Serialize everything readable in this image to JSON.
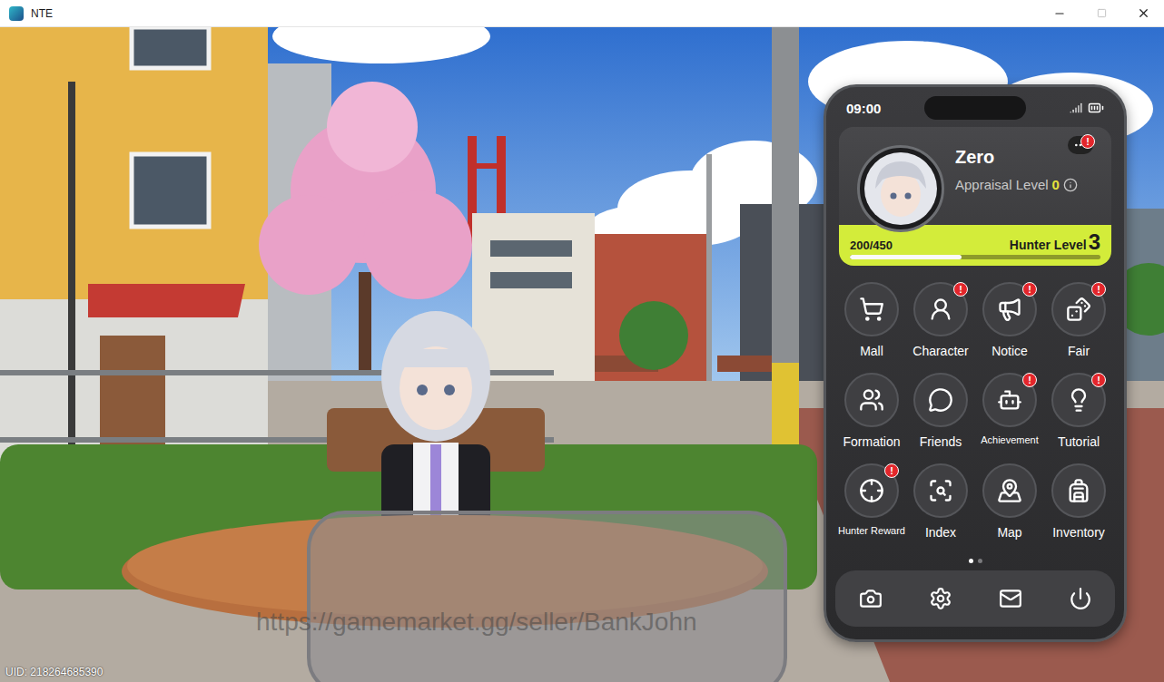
{
  "window": {
    "title": "NTE"
  },
  "game": {
    "uid": "UID: 218264685390",
    "watermark": "https://gamemarket.gg/seller/BankJohn"
  },
  "phone": {
    "status": {
      "time": "09:00"
    },
    "badge_mark": "!",
    "profile": {
      "name": "Zero",
      "appraisal_label": "Appraisal Level",
      "appraisal_value": "0",
      "exp": "200/450",
      "hunter_label": "Hunter Level",
      "hunter_value": "3",
      "level": 0.444,
      "menu_badge": true
    },
    "apps": [
      {
        "label": "Mall",
        "badge": false
      },
      {
        "label": "Character",
        "badge": true
      },
      {
        "label": "Notice",
        "badge": true
      },
      {
        "label": "Fair",
        "badge": true
      },
      {
        "label": "Formation",
        "badge": false
      },
      {
        "label": "Friends",
        "badge": false
      },
      {
        "label": "Achievement",
        "badge": true
      },
      {
        "label": "Tutorial",
        "badge": true
      },
      {
        "label": "Hunter Reward",
        "badge": true
      },
      {
        "label": "Index",
        "badge": false
      },
      {
        "label": "Map",
        "badge": false
      },
      {
        "label": "Inventory",
        "badge": false
      }
    ],
    "pages": [
      {
        "selected": true
      },
      {
        "selected": false
      }
    ]
  }
}
